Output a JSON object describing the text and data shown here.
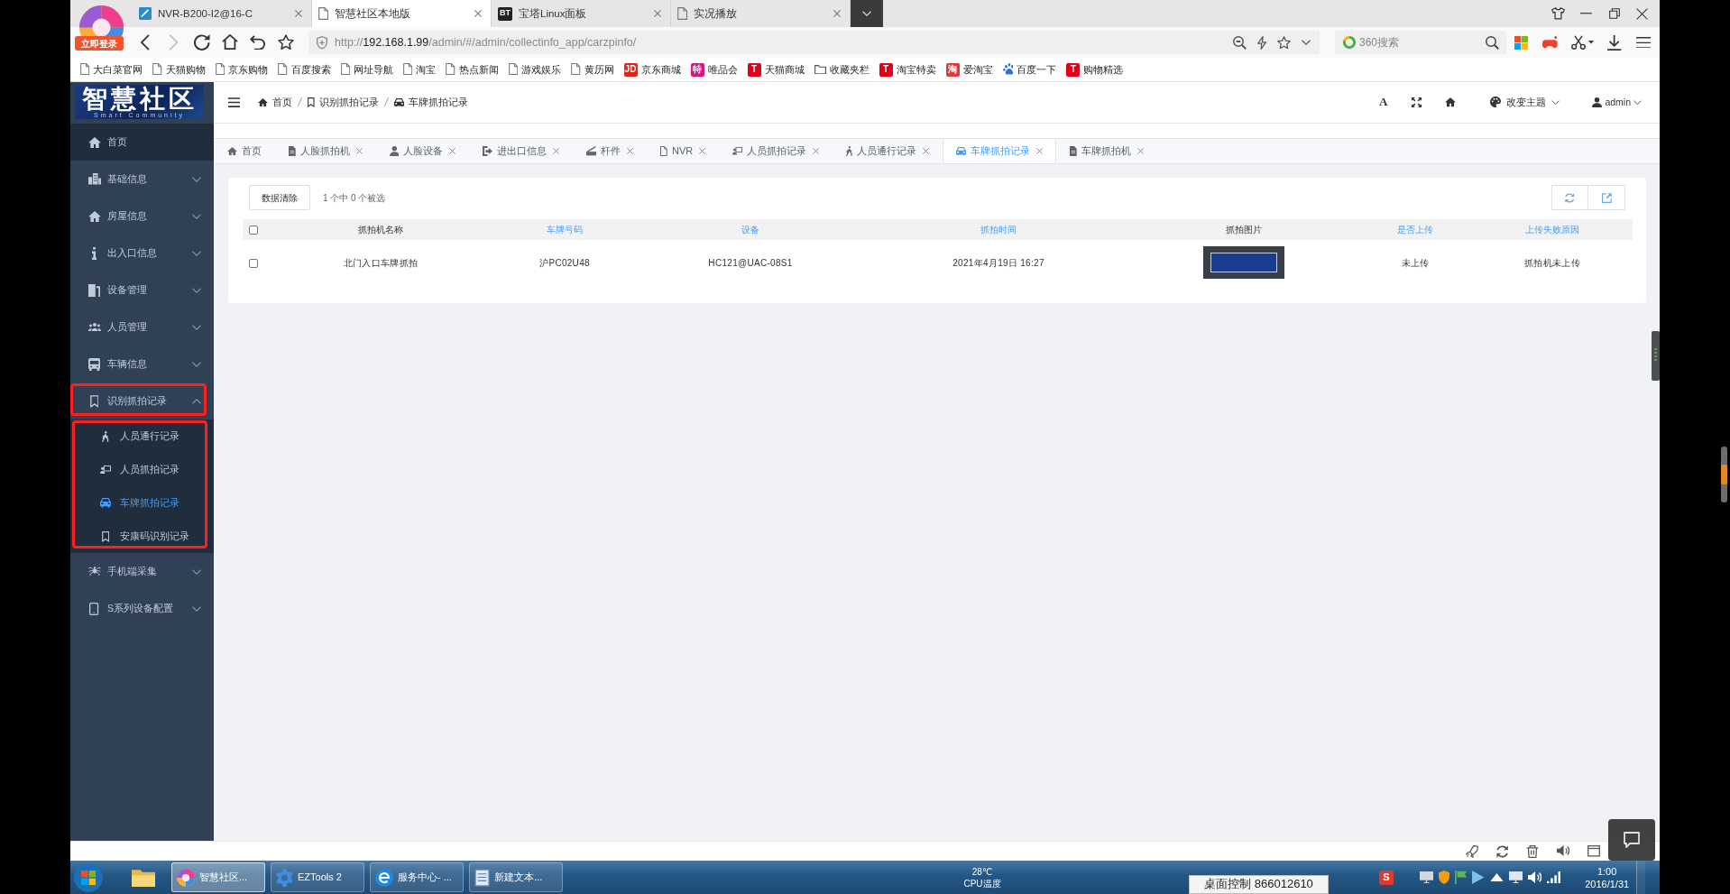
{
  "browser": {
    "logo_badge": "立即登录",
    "tabs": [
      {
        "kind": "tile",
        "title": "NVR-B200-I2@16-C",
        "selected": false
      },
      {
        "kind": "page",
        "title": "智慧社区本地版",
        "selected": true
      },
      {
        "kind": "badge",
        "badge_text": "BT",
        "title": "宝塔Linux面板",
        "selected": false
      },
      {
        "kind": "page",
        "title": "实况播放",
        "selected": false
      }
    ],
    "nav_buttons": [
      {
        "kind": "back",
        "disabled": false
      },
      {
        "kind": "forward",
        "disabled": true
      },
      {
        "kind": "reload",
        "disabled": false
      },
      {
        "kind": "home",
        "disabled": false
      },
      {
        "kind": "undo",
        "disabled": false
      },
      {
        "kind": "star",
        "disabled": false
      }
    ],
    "address": {
      "scheme": "http://",
      "host": "192.168.1.99",
      "path": "/admin/#/admin/collectinfo_app/carzpinfo/"
    },
    "search": {
      "placeholder": "360搜索"
    },
    "bookmarks": [
      {
        "kind": "page",
        "label": "大白菜官网"
      },
      {
        "kind": "page",
        "label": "天猫购物"
      },
      {
        "kind": "page",
        "label": "京东购物"
      },
      {
        "kind": "page",
        "label": "百度搜索"
      },
      {
        "kind": "page",
        "label": "网址导航"
      },
      {
        "kind": "page",
        "label": "淘宝"
      },
      {
        "kind": "page",
        "label": "热点新闻"
      },
      {
        "kind": "page",
        "label": "游戏娱乐"
      },
      {
        "kind": "page",
        "label": "黄历网"
      },
      {
        "kind": "badge",
        "badge_text": "JD",
        "color": "#d7281d",
        "label": "京东商城"
      },
      {
        "kind": "badge",
        "badge_text": "特",
        "color": "#d6197f",
        "label": "唯品会"
      },
      {
        "kind": "badge",
        "badge_text": "T",
        "color": "#e3001b",
        "label": "天猫商城"
      },
      {
        "kind": "folder",
        "label": "收藏夹栏"
      },
      {
        "kind": "badge",
        "badge_text": "T",
        "color": "#e3001b",
        "label": "淘宝特卖"
      },
      {
        "kind": "badge",
        "badge_text": "淘",
        "color": "#e4393c",
        "label": "爱淘宝"
      },
      {
        "kind": "paw",
        "label": "百度一下"
      },
      {
        "kind": "badge",
        "badge_text": "T",
        "color": "#e3001b",
        "label": "购物精选"
      }
    ]
  },
  "app": {
    "brand": "智慧社区",
    "brand_subtitle": "Smart Community",
    "sidebar": [
      {
        "label": "首页",
        "kind": "link",
        "highlighted": true,
        "framed": false
      },
      {
        "label": "基础信息",
        "kind": "group",
        "expanded": false,
        "highlighted": false,
        "framed": false
      },
      {
        "label": "房屋信息",
        "kind": "group",
        "expanded": false,
        "highlighted": false,
        "framed": false
      },
      {
        "label": "出入口信息",
        "kind": "group",
        "expanded": false,
        "highlighted": false,
        "framed": false
      },
      {
        "label": "设备管理",
        "kind": "group",
        "expanded": false,
        "highlighted": false,
        "framed": false
      },
      {
        "label": "人员管理",
        "kind": "group",
        "expanded": false,
        "highlighted": false,
        "framed": false
      },
      {
        "label": "车辆信息",
        "kind": "group",
        "expanded": false,
        "highlighted": false,
        "framed": false
      },
      {
        "label": "识别抓拍记录",
        "kind": "group",
        "expanded": true,
        "highlighted": false,
        "framed": true,
        "children_framed": true,
        "children": [
          {
            "label": "人员通行记录",
            "selected": false
          },
          {
            "label": "人员抓拍记录",
            "selected": false
          },
          {
            "label": "车牌抓拍记录",
            "selected": true
          },
          {
            "label": "安康码识别记录",
            "selected": false
          }
        ]
      },
      {
        "label": "手机端采集",
        "kind": "group",
        "expanded": false,
        "highlighted": false,
        "framed": false
      },
      {
        "label": "S系列设备配置",
        "kind": "group",
        "expanded": false,
        "highlighted": false,
        "framed": false
      }
    ],
    "header": {
      "breadcrumb": [
        "首页",
        "识别抓拍记录",
        "车牌抓拍记录"
      ],
      "font_button": "A",
      "theme_menu": "改变主题",
      "user_menu": "admin"
    },
    "tabs": [
      {
        "label": "首页",
        "closable": false,
        "selected": false
      },
      {
        "label": "人脸抓拍机",
        "closable": true,
        "selected": false
      },
      {
        "label": "人脸设备",
        "closable": true,
        "selected": false
      },
      {
        "label": "进出口信息",
        "closable": true,
        "selected": false
      },
      {
        "label": "杆件",
        "closable": true,
        "selected": false
      },
      {
        "label": "NVR",
        "closable": true,
        "selected": false
      },
      {
        "label": "人员抓拍记录",
        "closable": true,
        "selected": false
      },
      {
        "label": "人员通行记录",
        "closable": true,
        "selected": false
      },
      {
        "label": "车牌抓拍记录",
        "closable": true,
        "selected": true
      },
      {
        "label": "车牌抓拍机",
        "closable": true,
        "selected": false
      }
    ],
    "toolbar": {
      "clear_button": "数据清除",
      "selection_info": "1 个中 0 个被选"
    },
    "table": {
      "all_checked": false,
      "columns": [
        {
          "label": "抓拍机名称",
          "kind": "text",
          "sortable": false
        },
        {
          "label": "车牌号码",
          "kind": "text",
          "sortable": true
        },
        {
          "label": "设备",
          "kind": "text",
          "sortable": true
        },
        {
          "label": "抓拍时间",
          "kind": "text",
          "sortable": true
        },
        {
          "label": "抓拍图片",
          "kind": "image",
          "sortable": false
        },
        {
          "label": "是否上传",
          "kind": "text",
          "sortable": true
        },
        {
          "label": "上传失败原因",
          "kind": "text",
          "sortable": true
        }
      ],
      "rows": [
        {
          "checked": false,
          "cells": [
            "北门入口车牌抓拍",
            "沪PC02U48",
            "HC121@UAC-08S1",
            "2021年4月19日 16:27",
            "",
            "未上传",
            "抓拍机未上传"
          ]
        }
      ]
    }
  },
  "taskbar": {
    "tasks": [
      {
        "label": "智慧社区...",
        "selected": true
      },
      {
        "label": "EZTools 2",
        "selected": false
      },
      {
        "label": "服务中心- ...",
        "selected": false
      },
      {
        "label": "新建文本...",
        "selected": false
      }
    ],
    "cpu_temperature": "28℃",
    "cpu_label": "CPU温度",
    "remote_label": "桌面控制 866012610",
    "ime": "S",
    "time": "1:00",
    "date": "2016/1/31"
  }
}
